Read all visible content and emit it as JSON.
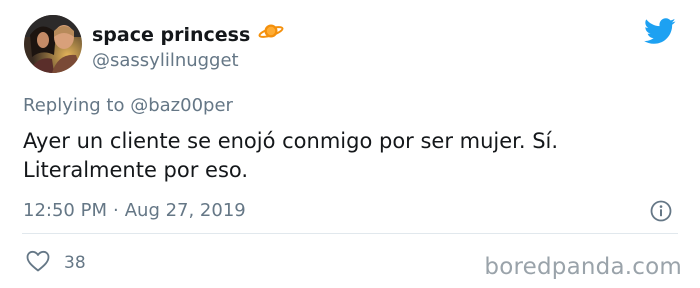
{
  "user": {
    "display_name": "space princess",
    "handle": "@sassylilnugget",
    "emoji_icon": "ringed-planet-icon"
  },
  "reply": {
    "prefix": "Replying to",
    "mention": "@baz00per"
  },
  "tweet": {
    "text": "Ayer un cliente se enojó conmigo por ser mujer. Sí. Literalmente por eso."
  },
  "meta": {
    "time": "12:50 PM",
    "separator": "·",
    "date": "Aug 27, 2019"
  },
  "actions": {
    "like_count": "38"
  },
  "watermark": "boredpanda.com",
  "colors": {
    "twitter_blue": "#1da1f2",
    "secondary_text": "#657786",
    "primary_text": "#14171a",
    "planet_orange": "#f4900c"
  }
}
